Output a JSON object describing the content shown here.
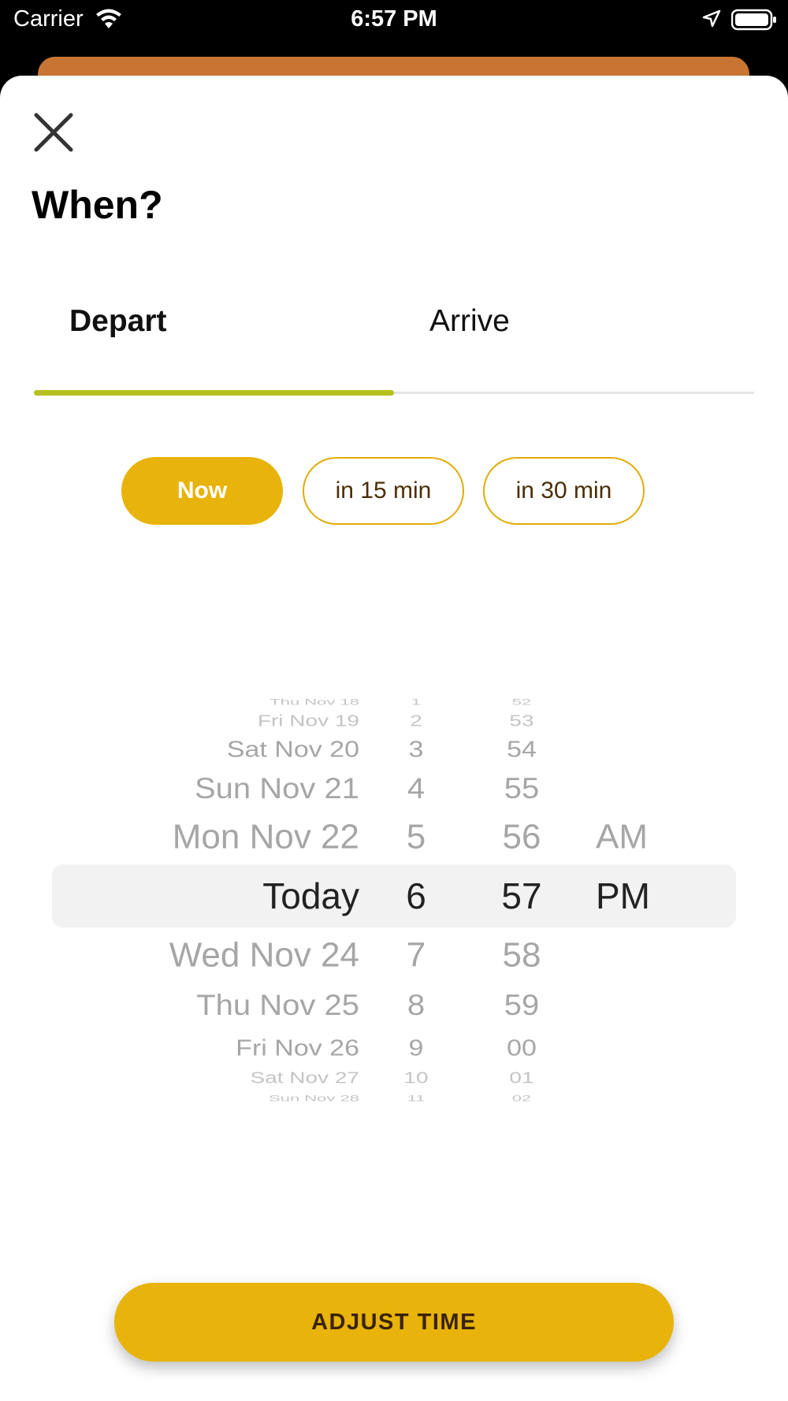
{
  "status_bar": {
    "carrier": "Carrier",
    "time": "6:57 PM",
    "icons": [
      "wifi-icon",
      "location-arrow-icon",
      "battery-icon"
    ]
  },
  "sheet": {
    "title": "When?",
    "tabs": [
      {
        "label": "Depart",
        "active": true
      },
      {
        "label": "Arrive",
        "active": false
      }
    ],
    "quick_options": [
      {
        "label": "Now",
        "selected": true
      },
      {
        "label": "in 15 min",
        "selected": false
      },
      {
        "label": "in 30 min",
        "selected": false
      }
    ],
    "picker": {
      "dates": [
        "Thu Nov 18",
        "Fri Nov 19",
        "Sat Nov 20",
        "Sun Nov 21",
        "Mon Nov 22",
        "Today",
        "Wed Nov 24",
        "Thu Nov 25",
        "Fri Nov 26",
        "Sat Nov 27",
        "Sun Nov 28"
      ],
      "hours": [
        "1",
        "2",
        "3",
        "4",
        "5",
        "6",
        "7",
        "8",
        "9",
        "10",
        "11"
      ],
      "minutes": [
        "52",
        "53",
        "54",
        "55",
        "56",
        "57",
        "58",
        "59",
        "00",
        "01",
        "02"
      ],
      "ampm": [
        "",
        "",
        "",
        "",
        "AM",
        "PM",
        "",
        "",
        "",
        "",
        ""
      ],
      "selected_index": 5
    },
    "adjust_button": "ADJUST TIME"
  },
  "colors": {
    "accent": "#e8b30a",
    "tab_indicator": "#b7c01c",
    "behind_card": "#c87432"
  }
}
